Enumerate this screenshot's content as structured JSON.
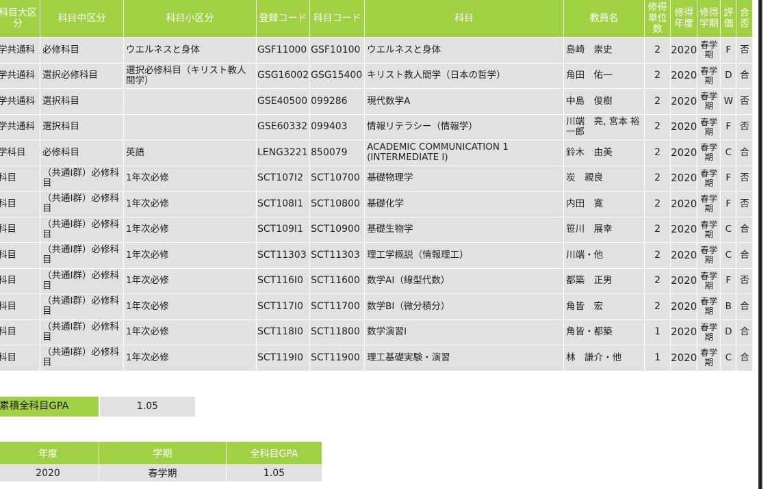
{
  "grades_table": {
    "headers": [
      "科目大区\n分",
      "科目中区分",
      "科目小区分",
      "登録コード",
      "科目コード",
      "科目",
      "教員名",
      "修得\n単位\n数",
      "修得\n年度",
      "修得\n学期",
      "評\n価",
      "合\n否"
    ],
    "rows": [
      [
        "学共通科",
        "必修科目",
        "ウエルネスと身体",
        "GSF11000",
        "GSF10100",
        "ウエルネスと身体",
        "島崎　崇史",
        "2",
        "2020",
        "春学期",
        "F",
        "否"
      ],
      [
        "学共通科",
        "選択必修科目",
        "選択必修科目（キリスト教人間学）",
        "GSG16002",
        "GSG15400",
        "キリスト教人間学（日本の哲学）",
        "角田　佑一",
        "2",
        "2020",
        "春学期",
        "D",
        "合"
      ],
      [
        "学共通科",
        "選択科目",
        "",
        "GSE40500",
        "099286",
        "現代数学A",
        "中島　俊樹",
        "2",
        "2020",
        "春学期",
        "W",
        "否"
      ],
      [
        "学共通科",
        "選択科目",
        "",
        "GSE60332",
        "099403",
        "情報リテラシー（情報学）",
        "川端　亮, 宮本 裕一郎",
        "2",
        "2020",
        "春学期",
        "F",
        "否"
      ],
      [
        "学科目",
        "必修科目",
        "英語",
        "LENG3221",
        "850079",
        "ACADEMIC COMMUNICATION 1 (INTERMEDIATE I)",
        "鈴木　由美",
        "2",
        "2020",
        "春学期",
        "C",
        "合"
      ],
      [
        "科目",
        "（共通Ⅰ群）必修科目",
        "1年次必修",
        "SCT107I2",
        "SCT10700",
        "基礎物理学",
        "炭　親良",
        "2",
        "2020",
        "春学期",
        "F",
        "否"
      ],
      [
        "科目",
        "（共通Ⅰ群）必修科目",
        "1年次必修",
        "SCT108I1",
        "SCT10800",
        "基礎化学",
        "内田　寛",
        "2",
        "2020",
        "春学期",
        "F",
        "否"
      ],
      [
        "科目",
        "（共通Ⅰ群）必修科目",
        "1年次必修",
        "SCT109I1",
        "SCT10900",
        "基礎生物学",
        "笹川　展幸",
        "2",
        "2020",
        "春学期",
        "C",
        "合"
      ],
      [
        "科目",
        "（共通Ⅰ群）必修科目",
        "1年次必修",
        "SCT11303",
        "SCT11303",
        "理工学概説（情報理工）",
        "川端・他",
        "2",
        "2020",
        "春学期",
        "C",
        "合"
      ],
      [
        "科目",
        "（共通Ⅰ群）必修科目",
        "1年次必修",
        "SCT116I0",
        "SCT11600",
        "数学AⅠ（線型代数）",
        "都築　正男",
        "2",
        "2020",
        "春学期",
        "F",
        "否"
      ],
      [
        "科目",
        "（共通Ⅰ群）必修科目",
        "1年次必修",
        "SCT117I0",
        "SCT11700",
        "数学BⅠ（微分積分）",
        "角皆　宏",
        "2",
        "2020",
        "春学期",
        "B",
        "合"
      ],
      [
        "科目",
        "（共通Ⅰ群）必修科目",
        "1年次必修",
        "SCT118I0",
        "SCT11800",
        "数学演習Ⅰ",
        "角皆・都築",
        "1",
        "2020",
        "春学期",
        "D",
        "合"
      ],
      [
        "科目",
        "（共通Ⅰ群）必修科目",
        "1年次必修",
        "SCT119I0",
        "SCT11900",
        "理工基礎実験・演習",
        "林　謙介・他",
        "1",
        "2020",
        "春学期",
        "C",
        "合"
      ]
    ]
  },
  "cumulative_gpa": {
    "label": "累積全科目GPA",
    "value": "1.05"
  },
  "term_gpa_table": {
    "headers": [
      "年度",
      "学期",
      "全科目GPA"
    ],
    "rows": [
      [
        "2020",
        "春学期",
        "1.05"
      ]
    ]
  }
}
